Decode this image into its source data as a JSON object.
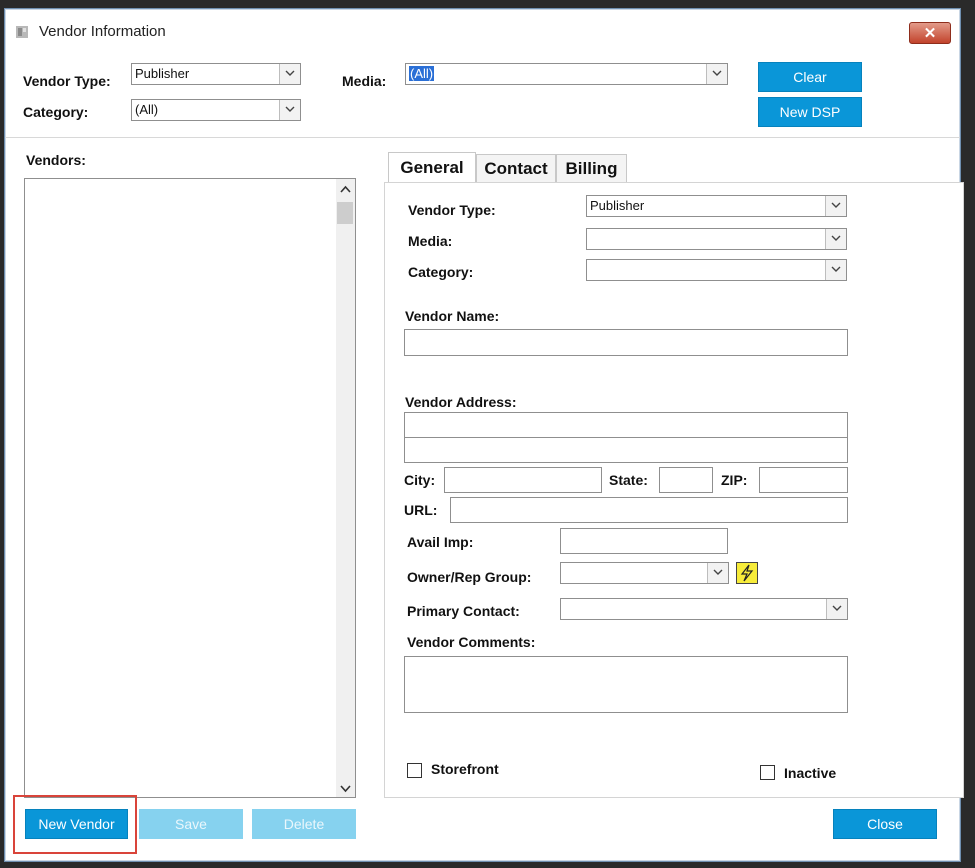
{
  "window": {
    "title": "Vendor Information",
    "close_label": "✕"
  },
  "filters": {
    "vendor_type_label": "Vendor Type:",
    "vendor_type_value": "Publisher",
    "media_label": "Media:",
    "media_value": "(All)",
    "category_label": "Category:",
    "category_value": "(All)",
    "clear_label": "Clear",
    "new_dsp_label": "New DSP"
  },
  "vendors": {
    "label": "Vendors:",
    "items": []
  },
  "tabs": [
    {
      "label": "General",
      "active": true
    },
    {
      "label": "Contact",
      "active": false
    },
    {
      "label": "Billing",
      "active": false
    }
  ],
  "general": {
    "vendor_type_label": "Vendor Type:",
    "vendor_type_value": "Publisher",
    "media_label": "Media:",
    "media_value": "",
    "category_label": "Category:",
    "category_value": "",
    "vendor_name_label": "Vendor Name:",
    "vendor_name_value": "",
    "vendor_address_label": "Vendor Address:",
    "address_line1": "",
    "address_line2": "",
    "city_label": "City:",
    "city_value": "",
    "state_label": "State:",
    "state_value": "",
    "zip_label": "ZIP:",
    "zip_value": "",
    "url_label": "URL:",
    "url_value": "",
    "avail_imp_label": "Avail Imp:",
    "avail_imp_value": "",
    "owner_rep_label": "Owner/Rep Group:",
    "owner_rep_value": "",
    "primary_contact_label": "Primary Contact:",
    "primary_contact_value": "",
    "vendor_comments_label": "Vendor Comments:",
    "vendor_comments_value": "",
    "storefront_label": "Storefront",
    "storefront_checked": false,
    "inactive_label": "Inactive",
    "inactive_checked": false
  },
  "footer": {
    "new_vendor_label": "New Vendor",
    "save_label": "Save",
    "delete_label": "Delete",
    "close_label": "Close"
  },
  "colors": {
    "button_blue": "#0a96d8",
    "button_disabled": "#86d2ef",
    "highlight_red": "#d9443a",
    "window_close_red": "#c2432c"
  }
}
